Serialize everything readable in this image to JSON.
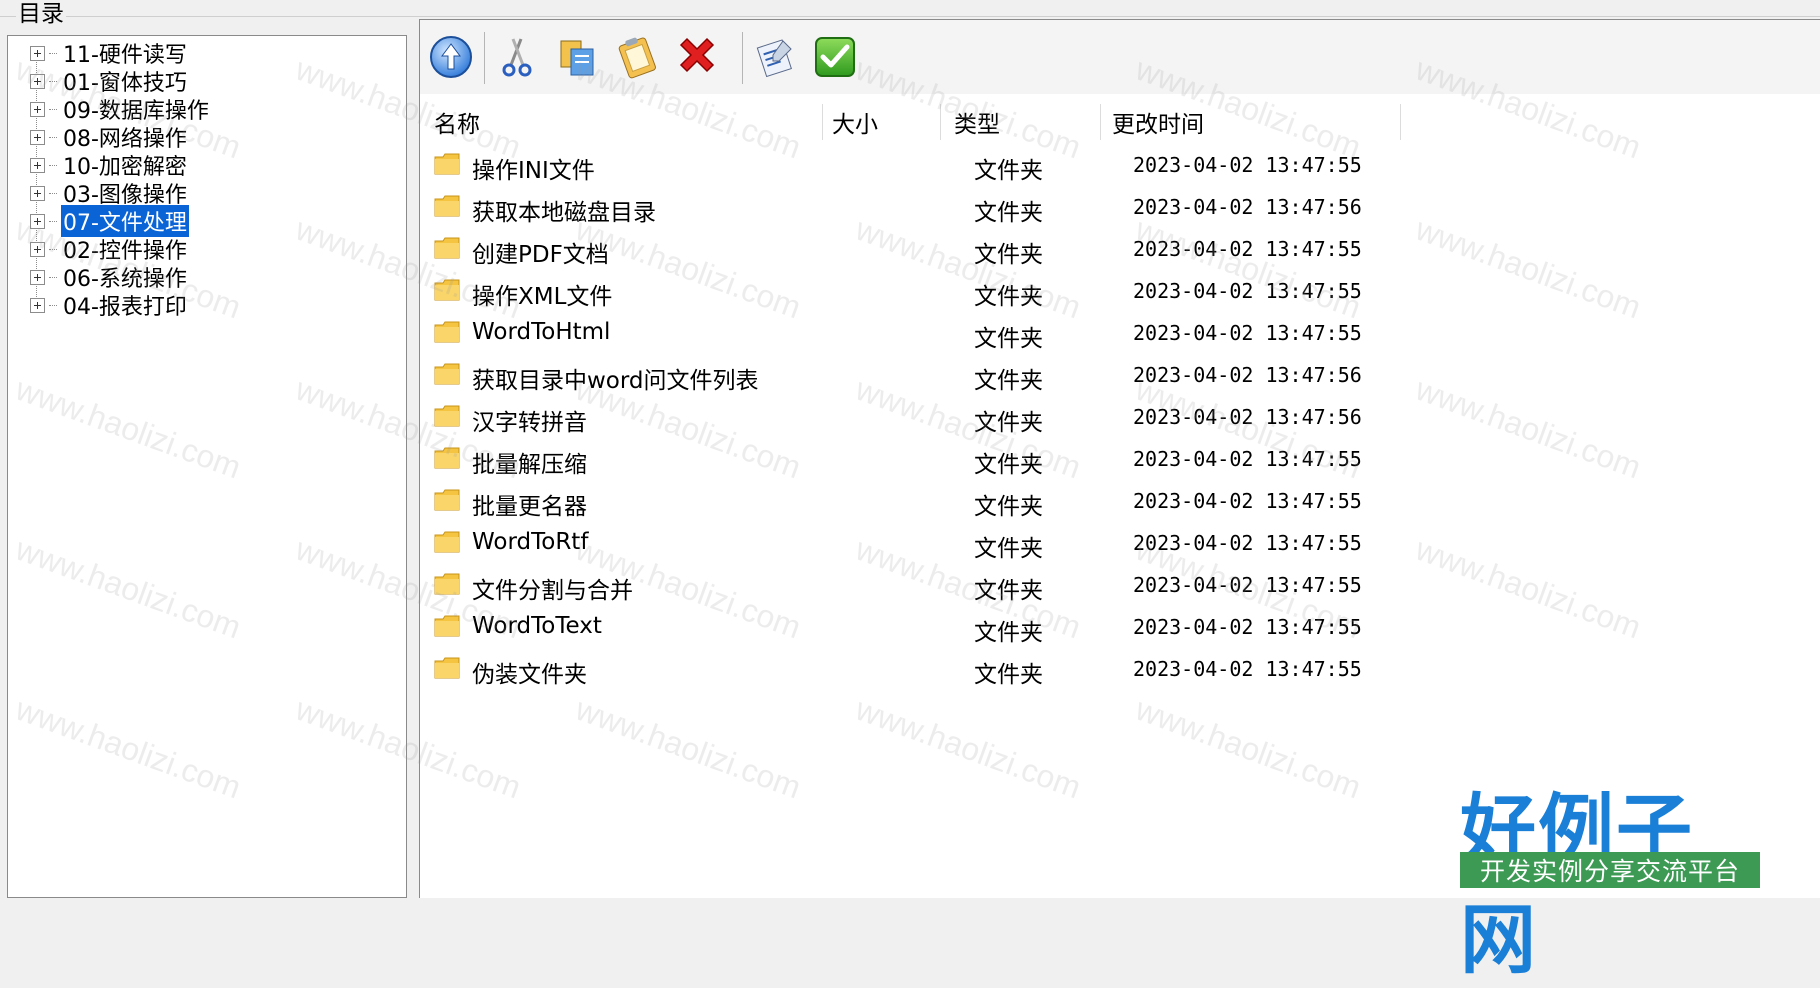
{
  "left_panel": {
    "title": "目录",
    "tree_items": [
      {
        "label": "11-硬件读写"
      },
      {
        "label": "01-窗体技巧"
      },
      {
        "label": "09-数据库操作"
      },
      {
        "label": "08-网络操作"
      },
      {
        "label": "10-加密解密"
      },
      {
        "label": "03-图像操作"
      },
      {
        "label": "07-文件处理",
        "selected": true
      },
      {
        "label": "02-控件操作"
      },
      {
        "label": "06-系统操作"
      },
      {
        "label": "04-报表打印"
      }
    ]
  },
  "toolbar": {
    "buttons": [
      {
        "name": "up",
        "icon": "up-arrow-icon"
      },
      {
        "name": "cut",
        "icon": "scissors-icon"
      },
      {
        "name": "copy",
        "icon": "copy-icon"
      },
      {
        "name": "paste",
        "icon": "paste-icon"
      },
      {
        "name": "delete",
        "icon": "delete-x-icon"
      },
      {
        "name": "rename",
        "icon": "rename-icon"
      },
      {
        "name": "confirm",
        "icon": "checkmark-icon"
      }
    ]
  },
  "file_list": {
    "columns": [
      "名称",
      "大小",
      "类型",
      "更改时间"
    ],
    "rows": [
      {
        "name": "操作INI文件",
        "type": "文件夹",
        "modified": "2023-04-02 13:47:55"
      },
      {
        "name": "获取本地磁盘目录",
        "type": "文件夹",
        "modified": "2023-04-02 13:47:56"
      },
      {
        "name": "创建PDF文档",
        "type": "文件夹",
        "modified": "2023-04-02 13:47:55"
      },
      {
        "name": "操作XML文件",
        "type": "文件夹",
        "modified": "2023-04-02 13:47:55"
      },
      {
        "name": "WordToHtml",
        "type": "文件夹",
        "modified": "2023-04-02 13:47:55"
      },
      {
        "name": "获取目录中word问文件列表",
        "type": "文件夹",
        "modified": "2023-04-02 13:47:56"
      },
      {
        "name": "汉字转拼音",
        "type": "文件夹",
        "modified": "2023-04-02 13:47:56"
      },
      {
        "name": "批量解压缩",
        "type": "文件夹",
        "modified": "2023-04-02 13:47:55"
      },
      {
        "name": "批量更名器",
        "type": "文件夹",
        "modified": "2023-04-02 13:47:55"
      },
      {
        "name": "WordToRtf",
        "type": "文件夹",
        "modified": "2023-04-02 13:47:55"
      },
      {
        "name": "文件分割与合并",
        "type": "文件夹",
        "modified": "2023-04-02 13:47:55"
      },
      {
        "name": "WordToText",
        "type": "文件夹",
        "modified": "2023-04-02 13:47:55"
      },
      {
        "name": "伪装文件夹",
        "type": "文件夹",
        "modified": "2023-04-02 13:47:55"
      }
    ]
  },
  "watermark": {
    "text": "www.haolizi.com",
    "logo_main": "好例子网",
    "logo_sub": "开发实例分享交流平台"
  },
  "colors": {
    "selection": "#0a64d6",
    "folder": "#f5c542",
    "logo_blue": "#1a7fd6",
    "logo_green": "#3c9a55"
  }
}
